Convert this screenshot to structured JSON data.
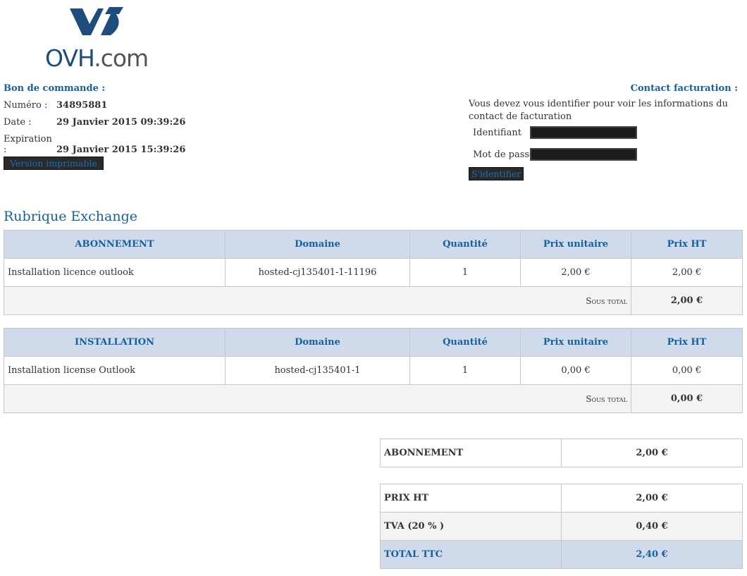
{
  "logo": {
    "brand": "OVH",
    "suffix": ".com"
  },
  "order": {
    "title": "Bon de commande :",
    "numero_label": "Numéro :",
    "numero": "34895881",
    "date_label": "Date :",
    "date": "29 Janvier 2015 09:39:26",
    "expiration_label": "Expiration :",
    "expiration": "29 Janvier 2015 15:39:26",
    "print_button": "Version imprimable"
  },
  "contact": {
    "title": "Contact facturation :",
    "message": "Vous devez vous identifier pour voir les informations du contact de facturation",
    "login_label": "Identifiant",
    "password_label": "Mot de passe",
    "submit": "S'identifier"
  },
  "section_title": "Rubrique Exchange",
  "tables": [
    {
      "headers": [
        "ABONNEMENT",
        "Domaine",
        "Quantité",
        "Prix unitaire",
        "Prix HT"
      ],
      "rows": [
        [
          "Installation licence outlook",
          "hosted-cj135401-1-11196",
          "1",
          "2,00 €",
          "2,00 €"
        ]
      ],
      "subtotal_label": "Sous total",
      "subtotal": "2,00 €"
    },
    {
      "headers": [
        "INSTALLATION",
        "Domaine",
        "Quantité",
        "Prix unitaire",
        "Prix HT"
      ],
      "rows": [
        [
          "Installation license Outlook",
          "hosted-cj135401-1",
          "1",
          "0,00 €",
          "0,00 €"
        ]
      ],
      "subtotal_label": "Sous total",
      "subtotal": "0,00 €"
    }
  ],
  "summary": {
    "abonnement_label": "ABONNEMENT",
    "abonnement": "2,00 €",
    "prix_ht_label": "PRIX HT",
    "prix_ht": "2,00 €",
    "tva_label": "TVA (20 % )",
    "tva": "0,40 €",
    "total_label": "TOTAL TTC",
    "total": "2,40 €"
  },
  "colors": {
    "accent": "#15609f",
    "header_bg": "#cfdaeb",
    "logo": "#1e4d7c"
  }
}
